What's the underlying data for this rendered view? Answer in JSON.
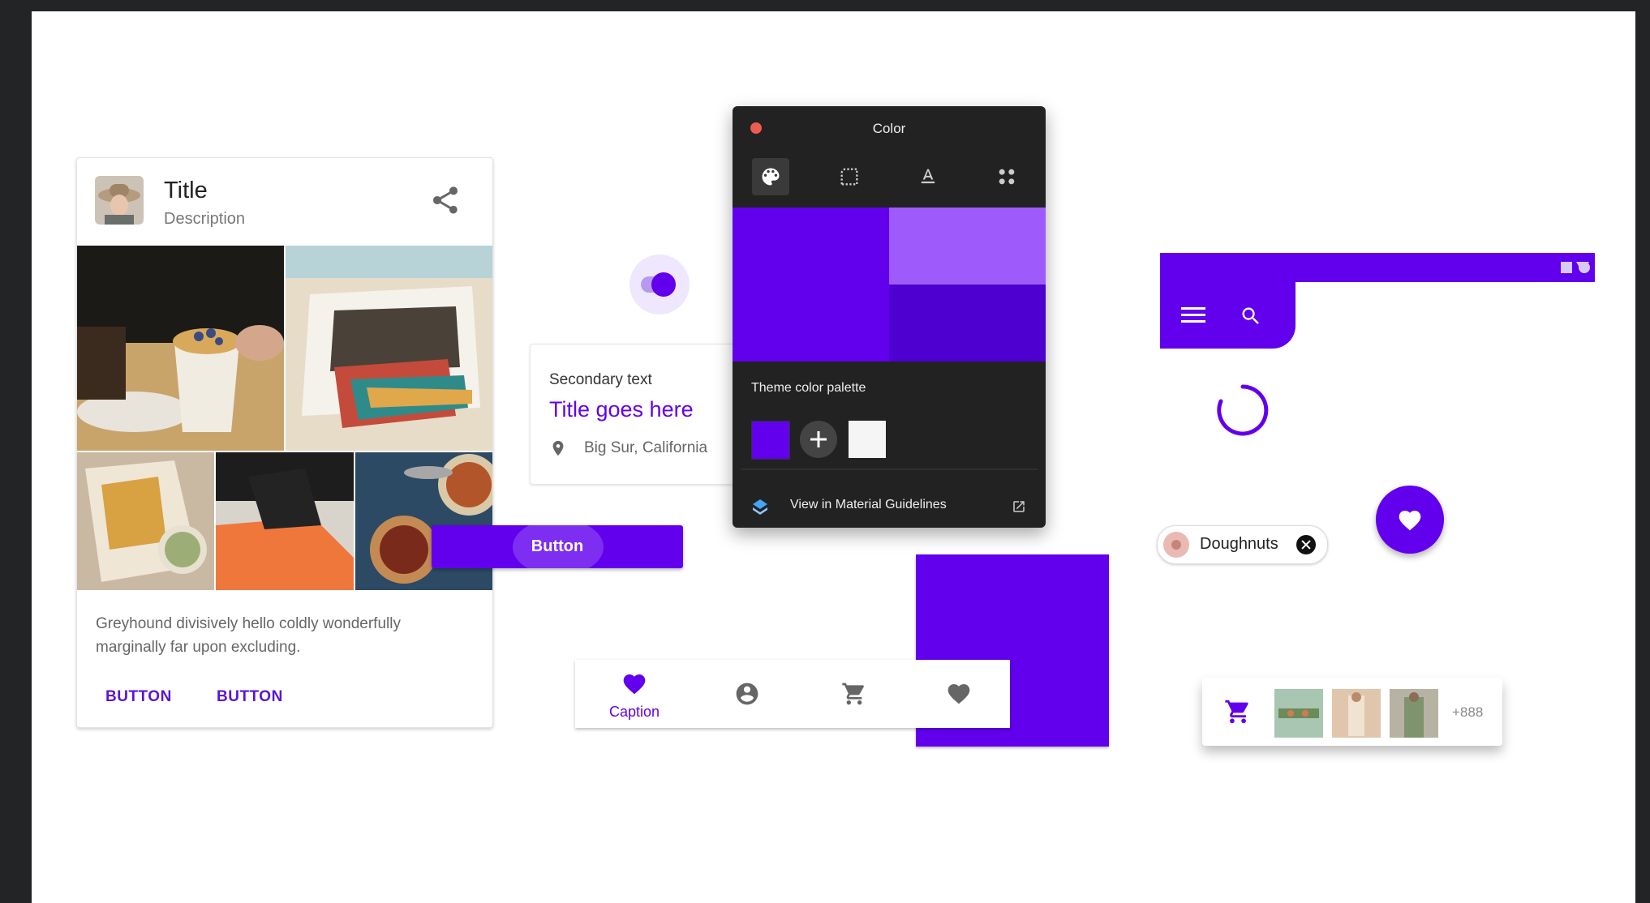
{
  "card": {
    "title": "Title",
    "description": "Description",
    "body": "Greyhound divisively hello coldly wonderfully marginally far upon excluding.",
    "button1": "BUTTON",
    "button2": "BUTTON"
  },
  "list_card": {
    "secondary": "Secondary text",
    "title": "Title goes here",
    "location": "Big Sur, California"
  },
  "contained_button": {
    "label": "Button"
  },
  "color_panel": {
    "title": "Color",
    "theme_label": "Theme color palette",
    "guidelines_link": "View in Material Guidelines"
  },
  "bottom_nav": {
    "caption": "Caption"
  },
  "chip": {
    "label": "Doughnuts"
  },
  "cart": {
    "more_count": "+888"
  },
  "colors": {
    "primary": "#6200ee",
    "primary_light": "#9f5afb",
    "primary_dark": "#4d00cf",
    "panel_bg": "#222222"
  }
}
